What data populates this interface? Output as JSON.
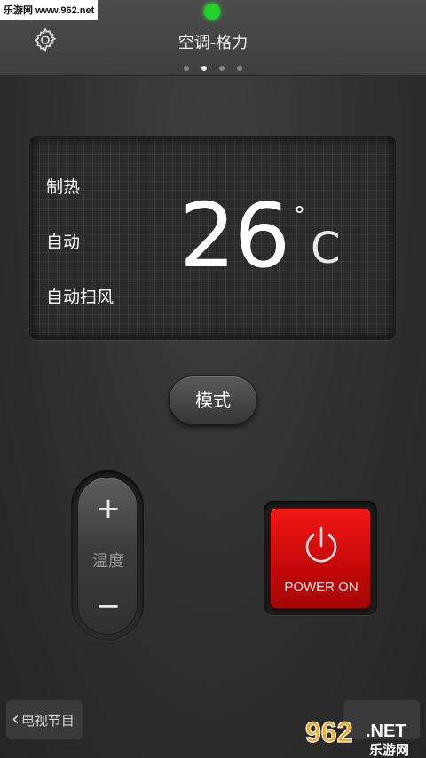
{
  "watermark_top": "乐游网 www.962.net",
  "header": {
    "title": "空调-格力",
    "pages": 4,
    "active_page": 1
  },
  "display": {
    "mode_lines": [
      "制热",
      "自动",
      "自动扫风"
    ],
    "temperature": "26",
    "degree": "°",
    "unit": "C"
  },
  "controls": {
    "mode_label": "模式",
    "temp_plus": "+",
    "temp_label": "温度",
    "temp_minus": "−",
    "power_label": "POWER ON"
  },
  "footer": {
    "back_label": "电视节目"
  },
  "logo": {
    "text": "962",
    "suffix": ".NET",
    "sub": "乐游网"
  },
  "colors": {
    "status": "#22d12b",
    "power": "#e01212"
  }
}
